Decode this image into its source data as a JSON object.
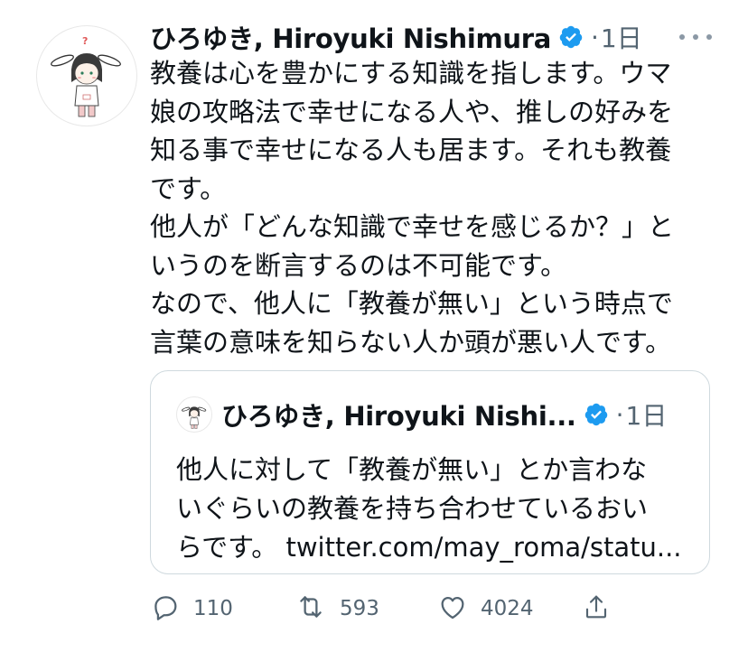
{
  "author": {
    "name": "ひろゆき, Hiroyuki Nishimura",
    "verified": true,
    "separator": "·",
    "time": "1日"
  },
  "tweet": {
    "lines": [
      "教養は心を豊かにする知識を指します。ウマ",
      "娘の攻略法で幸せになる人や、推しの好みを",
      "知る事で幸せになる人も居ます。それも教養",
      "です。",
      "他人が「どんな知識で幸せを感じるか？」と",
      "いうのを断言するのは不可能です。",
      "なので、他人に「教養が無い」という時点で",
      "言葉の意味を知らない人か頭が悪い人です。"
    ]
  },
  "quoted": {
    "name": "ひろゆき, Hiroyuki Nishi...",
    "verified": true,
    "separator": "·",
    "time": "1日",
    "lines": [
      "他人に対して「教養が無い」とか言わな",
      "いぐらいの教養を持ち合わせているおい",
      "らです。 twitter.com/may_roma/statu..."
    ]
  },
  "actions": {
    "reply": {
      "icon": "reply-icon",
      "count": "110"
    },
    "retweet": {
      "icon": "retweet-icon",
      "count": "593"
    },
    "like": {
      "icon": "heart-icon",
      "count": "4024"
    },
    "share": {
      "icon": "share-icon"
    }
  },
  "colors": {
    "text": "#0f1419",
    "secondary": "#536471",
    "verified": "#1d9bf0",
    "border": "#cfd9de"
  }
}
